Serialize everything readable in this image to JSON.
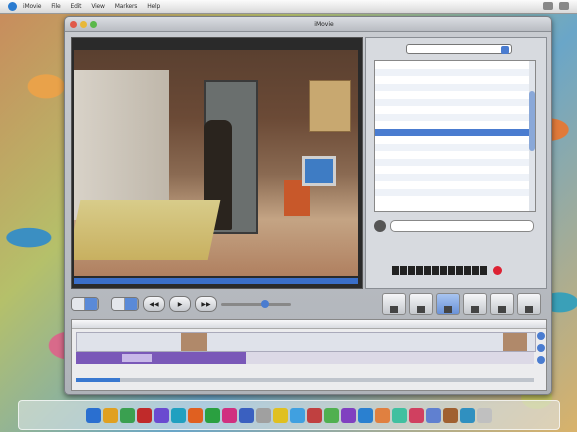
{
  "menubar": {
    "items": [
      "iMovie",
      "File",
      "Edit",
      "View",
      "Markers",
      "Help"
    ]
  },
  "window": {
    "title": "iMovie"
  },
  "sidebar": {
    "dropdown_value": "",
    "list_rows": [
      {
        "name": "",
        "value": ""
      },
      {
        "name": "",
        "value": ""
      },
      {
        "name": "",
        "value": ""
      },
      {
        "name": "",
        "value": ""
      },
      {
        "name": "",
        "value": ""
      },
      {
        "name": "",
        "value": ""
      },
      {
        "name": "",
        "value": ""
      },
      {
        "name": "",
        "value": ""
      },
      {
        "name": "",
        "value": ""
      },
      {
        "name": "",
        "value": ""
      },
      {
        "name": "",
        "value": ""
      },
      {
        "name": "",
        "value": ""
      },
      {
        "name": "",
        "value": ""
      },
      {
        "name": "",
        "value": ""
      },
      {
        "name": "",
        "value": ""
      },
      {
        "name": "",
        "value": ""
      },
      {
        "name": "",
        "value": ""
      },
      {
        "name": "",
        "value": ""
      },
      {
        "name": "",
        "value": ""
      }
    ],
    "selected_index": 9
  },
  "controls": {
    "timecode": "",
    "tool_labels": [
      "",
      "",
      "",
      "",
      "",
      ""
    ]
  },
  "status": {
    "left": "",
    "right": ""
  },
  "colors": {
    "accent": "#4a7cd0",
    "purple_clip": "#7a58b8",
    "record": "#dd2233"
  },
  "dock": {
    "icon_colors": [
      "#2a6fd0",
      "#e0a020",
      "#3aa050",
      "#c02a2a",
      "#6a4ad0",
      "#20a0c0",
      "#e06020",
      "#2aa040",
      "#d03080",
      "#3a60c0",
      "#a0a0a0",
      "#e0c020",
      "#40a0e0",
      "#c04040",
      "#50b050",
      "#8040c0",
      "#2a80d0",
      "#e08040",
      "#40c0a0",
      "#d04060",
      "#6080d0",
      "#a06030",
      "#3090c0",
      "#c0c0c0"
    ]
  }
}
